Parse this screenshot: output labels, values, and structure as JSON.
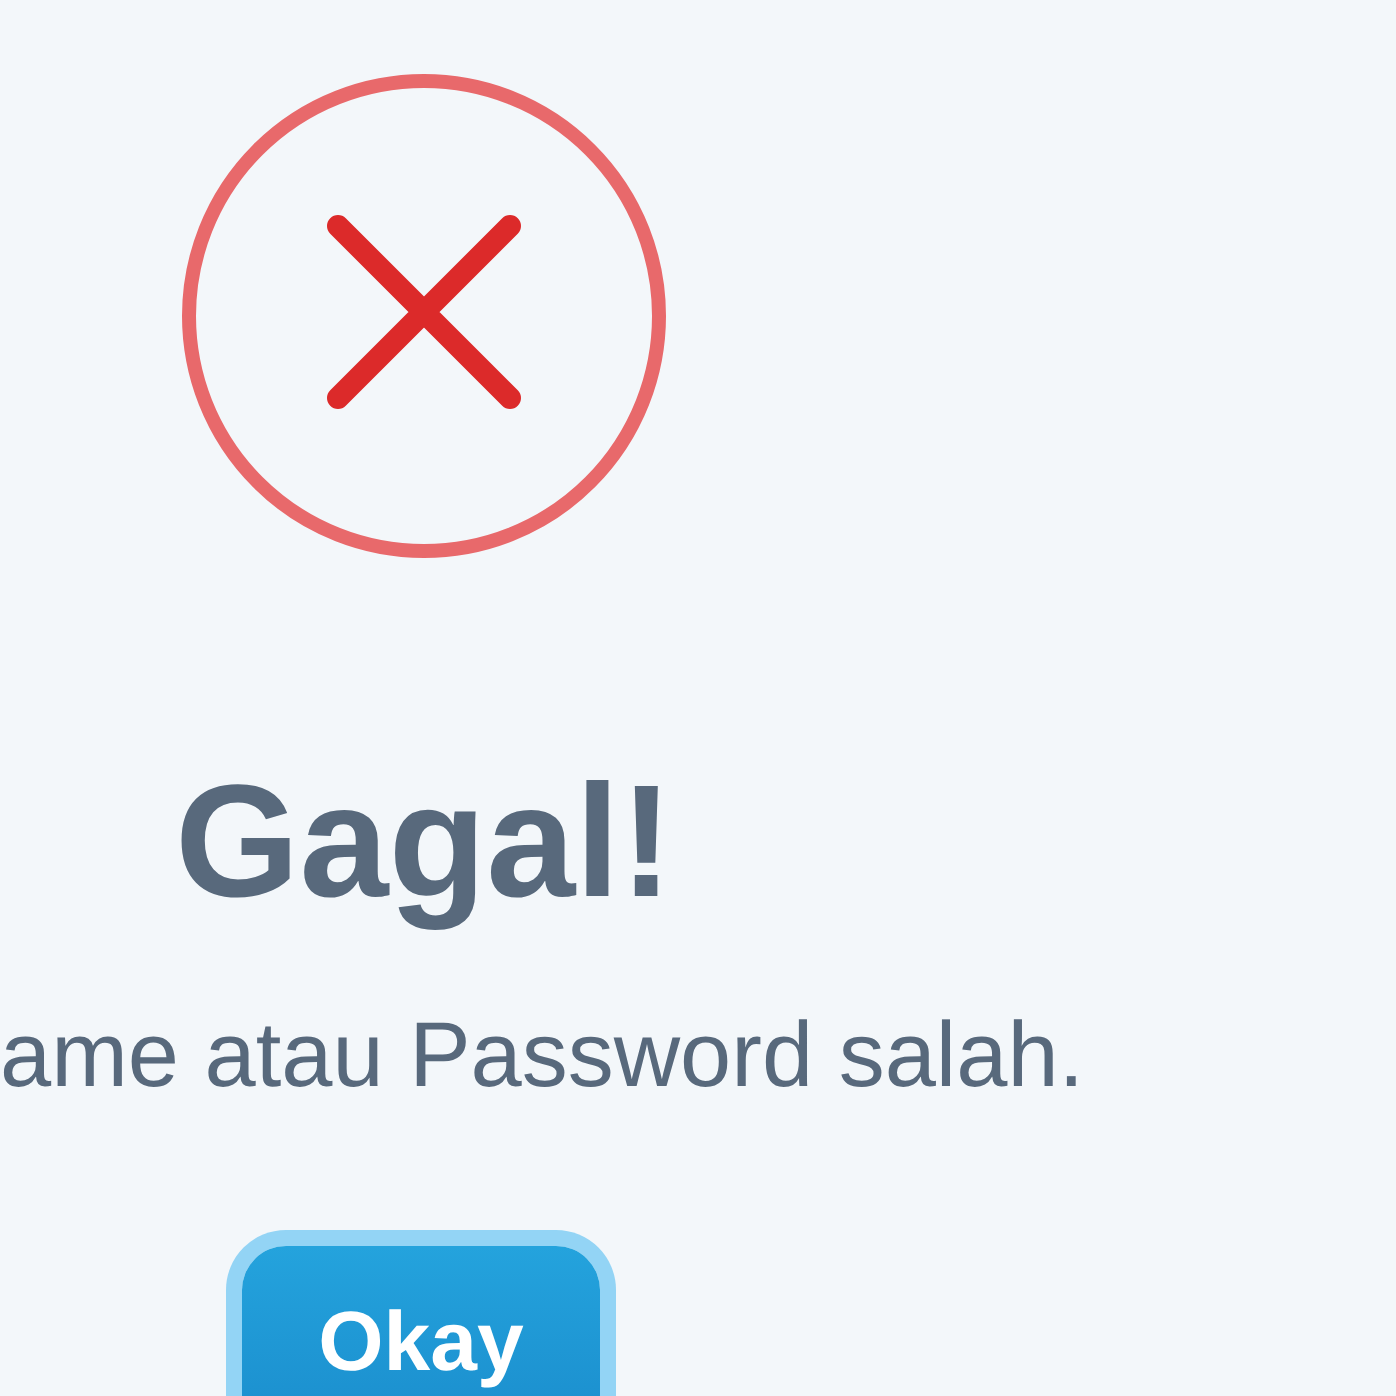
{
  "dialog": {
    "kind": "error",
    "title": "Gagal!",
    "message": "ame atau Password salah.",
    "button": {
      "label": "Okay",
      "focused": true
    }
  }
}
